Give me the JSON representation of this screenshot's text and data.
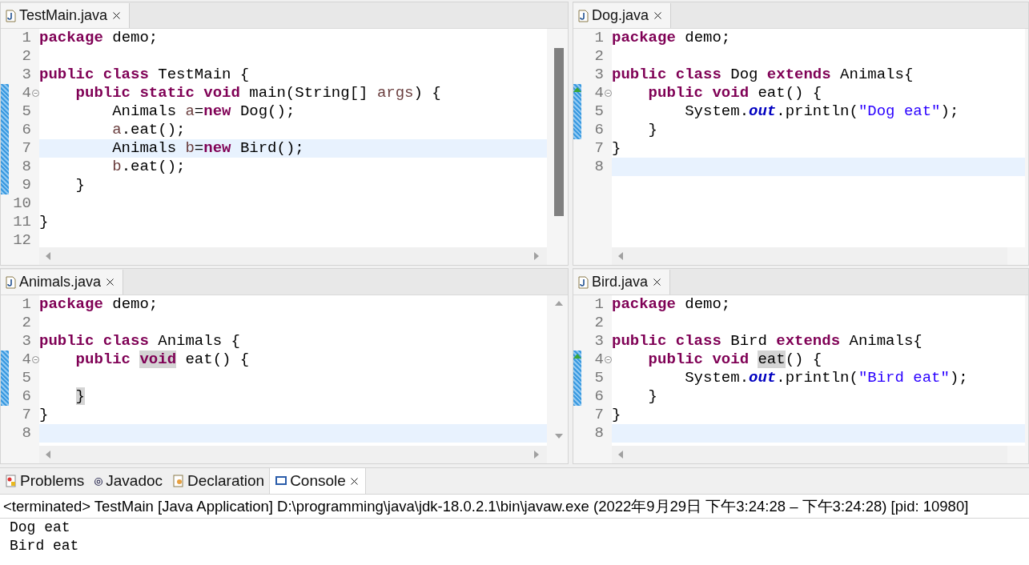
{
  "editors": [
    {
      "kind": "thumb",
      "tab": {
        "title": "TestMain.java",
        "selected": true
      },
      "lines": [
        {
          "number": "1",
          "tokens": [
            {
              "kind": "keyword",
              "text": "package"
            },
            {
              "kind": "text",
              "text": " demo;"
            }
          ]
        },
        {
          "number": "2"
        },
        {
          "number": "3",
          "tokens": [
            {
              "kind": "keyword",
              "text": "public class"
            },
            {
              "kind": "text",
              "text": " TestMain {"
            }
          ]
        },
        {
          "number": "4",
          "foldable": true,
          "changed": true,
          "tokens": [
            {
              "kind": "keyword",
              "text": "    public static void"
            },
            {
              "kind": "text",
              "text": " main(String[] "
            },
            {
              "kind": "variable",
              "text": "args"
            },
            {
              "kind": "text",
              "text": ") {"
            }
          ]
        },
        {
          "number": "5",
          "changed": true,
          "tokens": [
            {
              "kind": "text",
              "text": "        Animals "
            },
            {
              "kind": "variable",
              "text": "a"
            },
            {
              "kind": "text",
              "text": "="
            },
            {
              "kind": "keyword",
              "text": "new"
            },
            {
              "kind": "text",
              "text": " Dog();"
            }
          ]
        },
        {
          "number": "6",
          "changed": true,
          "tokens": [
            {
              "kind": "variable",
              "text": "        a"
            },
            {
              "kind": "text",
              "text": ".eat();"
            }
          ]
        },
        {
          "number": "7",
          "changed": true,
          "current": true,
          "tokens": [
            {
              "kind": "text",
              "text": "        Animals "
            },
            {
              "kind": "variable",
              "text": "b"
            },
            {
              "kind": "text",
              "text": "="
            },
            {
              "kind": "keyword",
              "text": "new"
            },
            {
              "kind": "text",
              "text": " Bird();"
            }
          ]
        },
        {
          "number": "8",
          "changed": true,
          "tokens": [
            {
              "kind": "variable",
              "text": "        b"
            },
            {
              "kind": "text",
              "text": ".eat();"
            }
          ]
        },
        {
          "number": "9",
          "changed": true,
          "tokens": [
            {
              "kind": "text",
              "text": "    }"
            }
          ]
        },
        {
          "number": "10"
        },
        {
          "number": "11",
          "tokens": [
            {
              "kind": "text",
              "text": "}"
            }
          ]
        },
        {
          "number": "12"
        }
      ]
    },
    {
      "kind": "plain",
      "tab": {
        "title": "Dog.java",
        "selected": true
      },
      "lines": [
        {
          "number": "1",
          "tokens": [
            {
              "kind": "keyword",
              "text": "package"
            },
            {
              "kind": "text",
              "text": " demo;"
            }
          ]
        },
        {
          "number": "2"
        },
        {
          "number": "3",
          "tokens": [
            {
              "kind": "keyword",
              "text": "public class"
            },
            {
              "kind": "text",
              "text": " Dog "
            },
            {
              "kind": "keyword",
              "text": "extends"
            },
            {
              "kind": "text",
              "text": " Animals{"
            }
          ]
        },
        {
          "number": "4",
          "foldable": true,
          "changed": true,
          "override": true,
          "tokens": [
            {
              "kind": "keyword",
              "text": "    public void"
            },
            {
              "kind": "text",
              "text": " eat() {"
            }
          ]
        },
        {
          "number": "5",
          "changed": true,
          "tokens": [
            {
              "kind": "text",
              "text": "        System."
            },
            {
              "kind": "field",
              "text": "out"
            },
            {
              "kind": "text",
              "text": ".println("
            },
            {
              "kind": "string",
              "text": "\"Dog eat\""
            },
            {
              "kind": "text",
              "text": ");"
            }
          ]
        },
        {
          "number": "6",
          "changed": true,
          "tokens": [
            {
              "kind": "text",
              "text": "    }"
            }
          ]
        },
        {
          "number": "7",
          "tokens": [
            {
              "kind": "text",
              "text": "}"
            }
          ]
        },
        {
          "number": "8",
          "current": true
        }
      ]
    },
    {
      "kind": "arrows",
      "tab": {
        "title": "Animals.java",
        "selected": true
      },
      "lines": [
        {
          "number": "1",
          "tokens": [
            {
              "kind": "keyword",
              "text": "package"
            },
            {
              "kind": "text",
              "text": " demo;"
            }
          ]
        },
        {
          "number": "2"
        },
        {
          "number": "3",
          "tokens": [
            {
              "kind": "keyword",
              "text": "public class"
            },
            {
              "kind": "text",
              "text": " Animals {"
            }
          ]
        },
        {
          "number": "4",
          "foldable": true,
          "changed": true,
          "tokens": [
            {
              "kind": "keyword",
              "text": "    public "
            },
            {
              "kind": "keyword",
              "text": "void",
              "marked": true
            },
            {
              "kind": "text",
              "text": " eat() {"
            }
          ]
        },
        {
          "number": "5",
          "changed": true
        },
        {
          "number": "6",
          "changed": true,
          "tokens": [
            {
              "kind": "text",
              "text": "    }",
              "marked": true
            }
          ]
        },
        {
          "number": "7",
          "tokens": [
            {
              "kind": "text",
              "text": "}"
            }
          ]
        },
        {
          "number": "8",
          "current": true
        }
      ]
    },
    {
      "kind": "plain",
      "tab": {
        "title": "Bird.java",
        "selected": true
      },
      "lines": [
        {
          "number": "1",
          "tokens": [
            {
              "kind": "keyword",
              "text": "package"
            },
            {
              "kind": "text",
              "text": " demo;"
            }
          ]
        },
        {
          "number": "2"
        },
        {
          "number": "3",
          "tokens": [
            {
              "kind": "keyword",
              "text": "public class"
            },
            {
              "kind": "text",
              "text": " Bird "
            },
            {
              "kind": "keyword",
              "text": "extends"
            },
            {
              "kind": "text",
              "text": " Animals{"
            }
          ]
        },
        {
          "number": "4",
          "foldable": true,
          "changed": true,
          "override": true,
          "tokens": [
            {
              "kind": "keyword",
              "text": "    public void "
            },
            {
              "kind": "text",
              "text": "eat",
              "marked": true
            },
            {
              "kind": "text",
              "text": "() {"
            }
          ]
        },
        {
          "number": "5",
          "changed": true,
          "tokens": [
            {
              "kind": "text",
              "text": "        System."
            },
            {
              "kind": "field",
              "text": "out"
            },
            {
              "kind": "text",
              "text": ".println("
            },
            {
              "kind": "string",
              "text": "\"Bird eat\""
            },
            {
              "kind": "text",
              "text": ");"
            }
          ]
        },
        {
          "number": "6",
          "changed": true,
          "tokens": [
            {
              "kind": "text",
              "text": "    }"
            }
          ]
        },
        {
          "number": "7",
          "tokens": [
            {
              "kind": "text",
              "text": "}"
            }
          ]
        },
        {
          "number": "8",
          "current": true
        }
      ]
    }
  ],
  "bottom_panel": {
    "tabs": [
      {
        "label": "Problems",
        "kind": "problems",
        "selected": false
      },
      {
        "label": "Javadoc",
        "kind": "javadoc",
        "selected": false
      },
      {
        "label": "Declaration",
        "kind": "declaration",
        "selected": false
      },
      {
        "label": "Console",
        "kind": "console",
        "selected": true
      }
    ],
    "status": "<terminated> TestMain [Java Application] D:\\programming\\java\\jdk-18.0.2.1\\bin\\javaw.exe  (2022年9月29日 下午3:24:28 – 下午3:24:28) [pid: 10980]",
    "output": [
      "Dog eat",
      "Bird eat"
    ]
  }
}
